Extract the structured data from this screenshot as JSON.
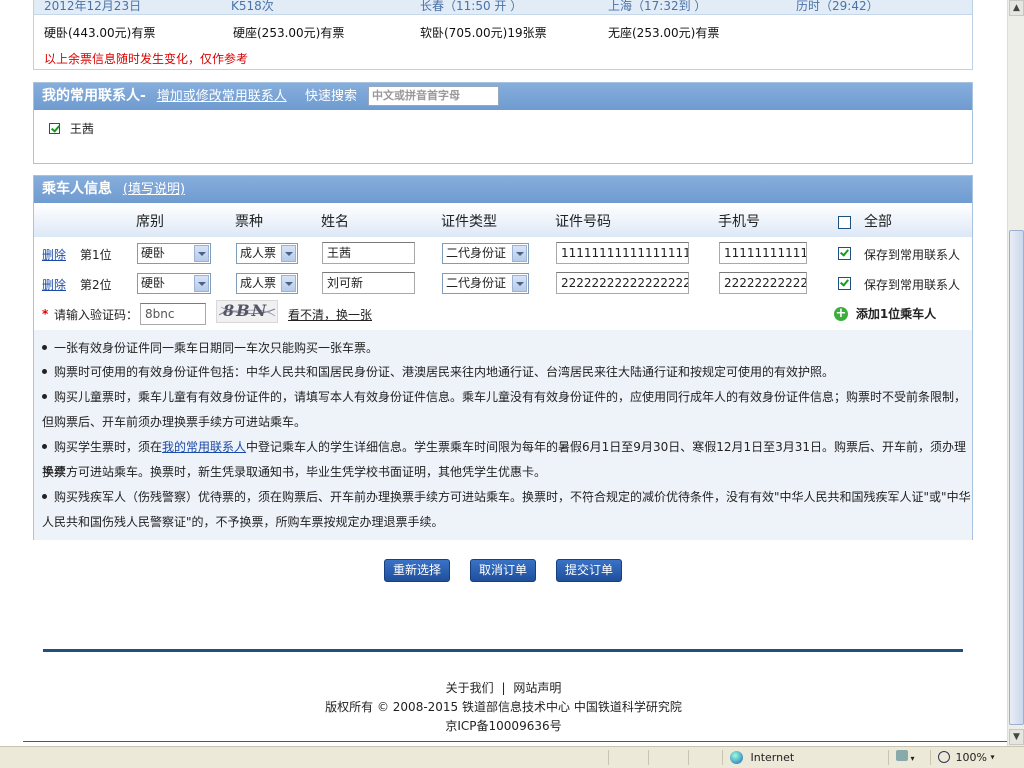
{
  "ticket": {
    "header": [
      "2012年12月23日",
      "K518次",
      "长春（11:50 开 ）",
      "上海（17:32到 ）",
      "历时（29:42）"
    ],
    "seats": [
      "硬卧(443.00元)有票",
      "硬座(253.00元)有票",
      "软卧(705.00元)19张票",
      "无座(253.00元)有票"
    ],
    "notice": "以上余票信息随时发生变化，仅作参考"
  },
  "contacts": {
    "title": "我的常用联系人-",
    "manage_link": "增加或修改常用联系人",
    "search_label": "快速搜索",
    "search_placeholder": "中文或拼音首字母",
    "items": [
      {
        "name": "王茜",
        "checked": true
      }
    ]
  },
  "passengers": {
    "title": "乘车人信息",
    "help_link": "(填写说明)",
    "columns": {
      "seat": "席别",
      "ticket_type": "票种",
      "name": "姓名",
      "id_type": "证件类型",
      "id_no": "证件号码",
      "phone": "手机号",
      "all": "全部"
    },
    "rows": [
      {
        "delete": "删除",
        "seq": "第1位",
        "seat": "硬卧",
        "ticket_type": "成人票",
        "name": "王茜",
        "id_type": "二代身份证",
        "id_no": "11111111111111111",
        "phone": "11111111111",
        "save_label": "保存到常用联系人",
        "save_checked": true
      },
      {
        "delete": "删除",
        "seq": "第2位",
        "seat": "硬卧",
        "ticket_type": "成人票",
        "name": "刘可新",
        "id_type": "二代身份证",
        "id_no": "222222222222222222",
        "phone": "22222222222",
        "save_label": "保存到常用联系人",
        "save_checked": true
      }
    ],
    "captcha_star": "*",
    "captcha_label": "请输入验证码：",
    "captcha_value": "8bnc",
    "captcha_image_text": "8BN",
    "captcha_refresh": "看不清，换一张",
    "add_passenger": "添加1位乘车人"
  },
  "tips": [
    "一张有效身份证件同一乘车日期同一车次只能购买一张车票。",
    "购票时可使用的有效身份证件包括：中华人民共和国居民身份证、港澳居民来往内地通行证、台湾居民来往大陆通行证和按规定可使用的有效护照。",
    "购买儿童票时，乘车儿童有有效身份证件的，请填写本人有效身份证件信息。乘车儿童没有有效身份证件的，应使用同行成年人的有效身份证件信息；购票时不受前条限制，",
    "但购票后、开车前须办理换票手续方可进站乘车。",
    "购买学生票时，须在",
    "我的常用联系人",
    "中登记乘车人的学生详细信息。学生票乘车时间限为每年的暑假6月1日至9月30日、寒假12月1日至3月31日。购票后、开车前，须办理换票",
    "手续方可进站乘车。换票时，新生凭录取通知书，毕业生凭学校书面证明，其他凭学生优惠卡。",
    "购买残疾军人（伤残警察）优待票的，须在购票后、开车前办理换票手续方可进站乘车。换票时，不符合规定的减价优待条件，没有有效\"中华人民共和国残疾军人证\"或\"中华",
    "人民共和国伤残人民警察证\"的，不予换票，所购车票按规定办理退票手续。"
  ],
  "buttons": {
    "reset": "重新选择",
    "cancel": "取消订单",
    "submit": "提交订单"
  },
  "footer": {
    "about": "关于我们",
    "sep": "|",
    "statement": "网站声明",
    "copyright": "版权所有 © 2008-2015 铁道部信息技术中心 中国铁道科学研究院",
    "icp": "京ICP备10009636号"
  },
  "statusbar": {
    "zone": "Internet",
    "zoom": "100%"
  },
  "colors": {
    "header_blue": "#7aa6d8",
    "button_blue": "#2a5fb0",
    "notice_red": "#dd0000",
    "footer_navy": "#22507e"
  }
}
